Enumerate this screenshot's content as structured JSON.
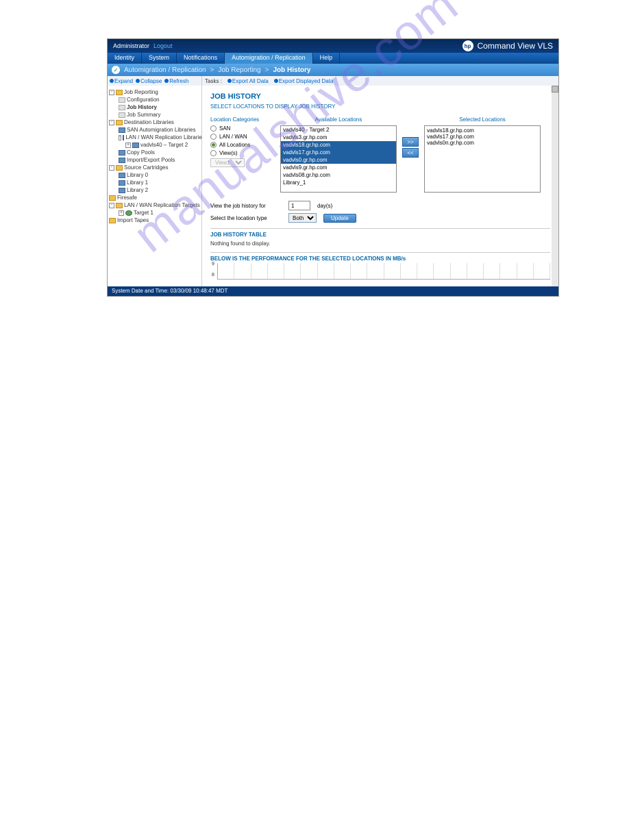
{
  "header": {
    "user": "Administrator",
    "logout": "Logout",
    "product": "Command View VLS",
    "hp": "hp"
  },
  "tabs": {
    "identity": "Identity",
    "system": "System",
    "notifications": "Notifications",
    "automigration": "Automigration / Replication",
    "help": "Help"
  },
  "breadcrumb": {
    "a": "Automigration / Replication",
    "b": "Job Reporting",
    "c": "Job History",
    "sep": ">"
  },
  "tree_toolbar": {
    "expand": "Expand",
    "collapse": "Collapse",
    "refresh": "Refresh"
  },
  "tasks_toolbar": {
    "label": "Tasks :",
    "export_all": "Export All Data",
    "export_disp": "Export Displayed Data"
  },
  "tree": {
    "job_reporting": "Job Reporting",
    "configuration": "Configuration",
    "job_history": "Job History",
    "job_summary": "Job Summary",
    "dest_libs": "Destination Libraries",
    "san_auto": "SAN Automigration Libraries",
    "lanwan_rep": "LAN / WAN Replication Libraries",
    "vadvls40": "vadvls40 – Target 2",
    "copy_pools": "Copy Pools",
    "import_export": "Import/Export Pools",
    "source_cart": "Source Cartridges",
    "lib0": "Library 0",
    "lib1": "Library 1",
    "lib2": "Library 2",
    "firesafe": "Firesafe",
    "lanwan_targets": "LAN / WAN Replication Targets",
    "target1": "Target 1",
    "import_tapes": "Import Tapes"
  },
  "content": {
    "title": "JOB HISTORY",
    "subtitle": "SELECT LOCATIONS TO DISPLAY JOB HISTORY",
    "col_categories": "Location Categories",
    "col_available": "Available Locations",
    "col_selected": "Selected Locations",
    "radio_san": "SAN",
    "radio_lanwan": "LAN / WAN",
    "radio_all": "All Locations",
    "radio_views": "View(s)",
    "view_select": "View1",
    "available": {
      "0": "vadvls40 - Target 2",
      "1": "vadvls3.gr.hp.com",
      "2": "vadvls18.gr.hp.com",
      "3": "vadvls17.gr.hp.com",
      "4": "vadvls0.gr.hp.com",
      "5": "vadvls9.gr.hp.com",
      "6": "vadvls08.gr.hp.com",
      "7": "Library_1"
    },
    "selected": {
      "0": "vadvls18.gr.hp.com",
      "1": "vadvls17.gr.hp.com",
      "2": "vadvls0n.gr.hp.com"
    },
    "move_right": ">>",
    "move_left": "<<",
    "view_history_label": "View the job history for",
    "days_value": "1",
    "days_suffix": "day(s)",
    "location_type_label": "Select the location type",
    "location_type_value": "Both",
    "update": "Update",
    "history_table_head": "JOB HISTORY TABLE",
    "nothing": "Nothing found to display.",
    "perf_head": "BELOW IS THE PERFORMANCE FOR THE SELECTED LOCATIONS IN MB/s"
  },
  "chart_data": {
    "type": "line",
    "categories": [],
    "values": [],
    "title": "",
    "xlabel": "",
    "ylabel": "",
    "ylim": [
      8,
      9
    ],
    "y_ticks": [
      "9",
      "8"
    ]
  },
  "status": "System Date and Time: 03/30/09 10:48:47 MDT",
  "watermark": "manualshive.com"
}
